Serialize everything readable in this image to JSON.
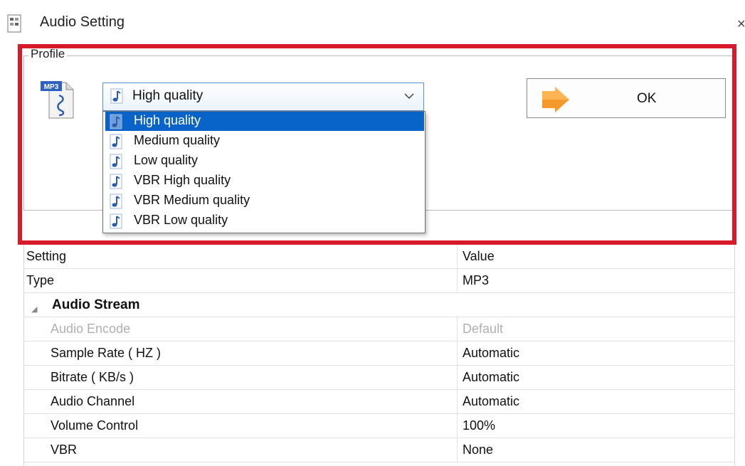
{
  "window": {
    "title": "Audio Setting",
    "close_glyph": "×"
  },
  "profile": {
    "legend": "Profile",
    "file_icon_badge": "MP3",
    "selected": "High quality",
    "options": [
      "High quality",
      "Medium quality",
      "Low quality",
      "VBR High quality",
      "VBR Medium quality",
      "VBR Low quality"
    ],
    "selected_index": 0,
    "ok_label": "OK"
  },
  "grid": {
    "header": {
      "setting": "Setting",
      "value": "Value"
    },
    "type_row": {
      "setting": "Type",
      "value": "MP3"
    },
    "category": "Audio Stream",
    "rows": [
      {
        "setting": "Audio Encode",
        "value": "Default",
        "disabled": true
      },
      {
        "setting": "Sample Rate ( HZ )",
        "value": "Automatic"
      },
      {
        "setting": "Bitrate ( KB/s )",
        "value": "Automatic"
      },
      {
        "setting": "Audio Channel",
        "value": "Automatic"
      },
      {
        "setting": "Volume Control",
        "value": "100%"
      },
      {
        "setting": "VBR",
        "value": "None"
      }
    ]
  },
  "colors": {
    "annotation": "#d8192a",
    "selection": "#0a63c8",
    "combo_border": "#5a8fd0"
  },
  "icons": [
    "app-icon",
    "mp3-file-icon",
    "music-note-icon",
    "chevron-down-icon",
    "ok-arrow-icon",
    "close-icon",
    "collapse-triangle-icon"
  ]
}
